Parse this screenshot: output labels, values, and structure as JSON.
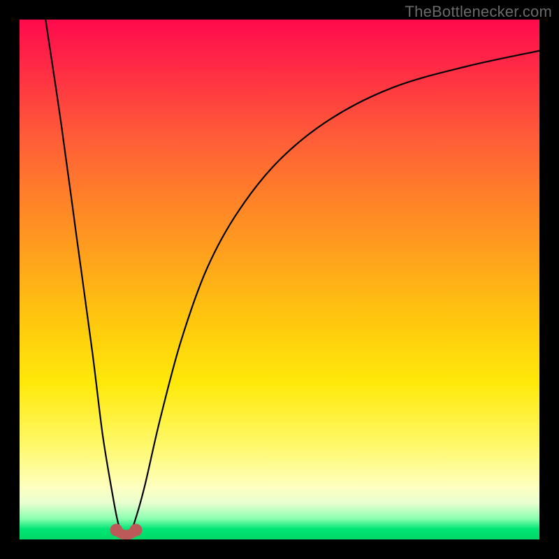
{
  "attribution": "TheBottlenecker.com",
  "colors": {
    "frame": "#000000",
    "gradient_top": "#ff0a4d",
    "gradient_mid": "#ffe90a",
    "gradient_bottom": "#00d966",
    "curve": "#000000",
    "marker": "#bb5a58"
  },
  "chart_data": {
    "type": "line",
    "title": "",
    "xlabel": "",
    "ylabel": "",
    "xlim": [
      0,
      100
    ],
    "ylim": [
      0,
      100
    ],
    "annotations": [
      "TheBottlenecker.com"
    ],
    "notes": "V-shaped bottleneck curve over heat gradient. y ≈ 100 meets top (red), y ≈ 0 meets bottom (green). Minimum of curve marked with small reddish blob near x≈20.",
    "series": [
      {
        "name": "bottleneck-curve",
        "x": [
          5,
          8,
          11,
          14,
          16,
          18,
          19,
          20,
          21,
          22,
          24,
          27,
          31,
          36,
          42,
          50,
          60,
          72,
          86,
          100
        ],
        "y": [
          100,
          80,
          58,
          36,
          20,
          8,
          3,
          1,
          1,
          3,
          10,
          23,
          38,
          52,
          63,
          73,
          81,
          87,
          91,
          94
        ]
      }
    ],
    "optimum_marker": {
      "x": 20.5,
      "y": 1
    }
  }
}
